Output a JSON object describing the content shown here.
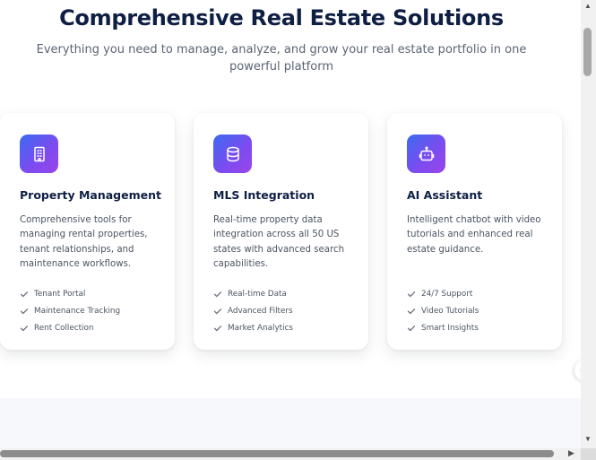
{
  "section": {
    "title": "Comprehensive Real Estate Solutions",
    "subtitle": "Everything you need to manage, analyze, and grow your real estate portfolio in one powerful platform"
  },
  "cards": [
    {
      "icon": "building-icon",
      "title": "Property Management",
      "description": "Comprehensive tools for managing rental properties, tenant relationships, and maintenance workflows.",
      "features": [
        "Tenant Portal",
        "Maintenance Tracking",
        "Rent Collection"
      ]
    },
    {
      "icon": "database-icon",
      "title": "MLS Integration",
      "description": "Real-time property data integration across all 50 US states with advanced search capabilities.",
      "features": [
        "Real-time Data",
        "Advanced Filters",
        "Market Analytics"
      ]
    },
    {
      "icon": "robot-icon",
      "title": "AI Assistant",
      "description": "Intelligent chatbot with video tutorials and enhanced real estate guidance.",
      "features": [
        "24/7 Support",
        "Video Tutorials",
        "Smart Insights"
      ]
    }
  ],
  "colors": {
    "heading": "#0f1f44",
    "icon_gradient_start": "#3b6cf0",
    "icon_gradient_end": "#9b45ea",
    "check": "#6b7280"
  },
  "widget": {
    "icon": "brain-icon"
  }
}
